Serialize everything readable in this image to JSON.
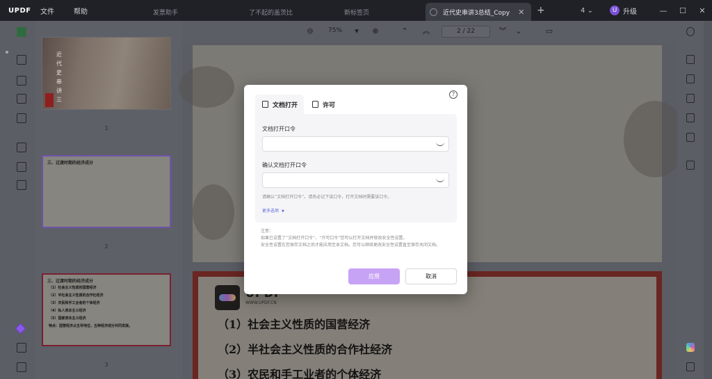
{
  "app": {
    "logo": "UPDF",
    "menu": [
      "文件",
      "帮助"
    ]
  },
  "tabs": [
    {
      "label": "发票助手"
    },
    {
      "label": "了不起的盖茨比"
    },
    {
      "label": "新标签页"
    },
    {
      "label": "近代史串讲3总结_Copy"
    }
  ],
  "titlebar": {
    "new_tab_icon": "+",
    "tab_count": "4",
    "tab_count_caret": "⌄",
    "avatar_letter": "U",
    "upgrade_label": "升级",
    "window_buttons": {
      "minimize": "—",
      "maximize": "☐",
      "close": "✕"
    }
  },
  "toolbar": {
    "zoom": "75%",
    "page_indicator": "2 / 22"
  },
  "thumbnails": [
    {
      "page_number": "1",
      "vertical_title": "近代史串讲三"
    },
    {
      "page_number": "2",
      "header": "三、过渡时期的经济成分"
    },
    {
      "page_number": "3",
      "header": "三、过渡时期的经济成分",
      "lines": [
        "（1）社会主义性质的国营经济",
        "（2）半社会主义性质的合作社经济",
        "（3）农民和手工业者的个体经济",
        "（4）私人资本主义经济",
        "（5）国家资本主义经济",
        "特点：国营经济占主导地位，五种经济成分共同发展。"
      ]
    }
  ],
  "page2_content": {
    "brand": "UPDF",
    "url": "WWW.UPDF.CN",
    "lines": [
      "（1）社会主义性质的国营经济",
      "（2）半社会主义性质的合作社经济",
      "（3）农民和手工业者的个体经济"
    ]
  },
  "dialog": {
    "help_icon": "?",
    "tabs": {
      "open": "文档打开",
      "permission": "许可"
    },
    "open_password_label": "文档打开口令",
    "confirm_password_label": "确认文档打开口令",
    "open_password_value": "",
    "confirm_password_value": "",
    "hint": "请确认“文档打开口令”。请务必记下该口令，打开文档时需要该口令。",
    "more_options": "更多选项",
    "notes": {
      "title": "注意：",
      "line1": "如果已设置了“文档打开口令”、“许可口令”您可以打开文档并修改安全性设置。",
      "line2": "安全性设置在您保存文档之后才能应用至本文档。您可以继续更改安全性设置直至保存关闭文档。"
    },
    "apply": "应用",
    "cancel": "取消"
  },
  "colors": {
    "accent_purple": "#c7a3f5",
    "titlebar_bg": "#1f2127",
    "link_blue": "#5b6bd8"
  }
}
